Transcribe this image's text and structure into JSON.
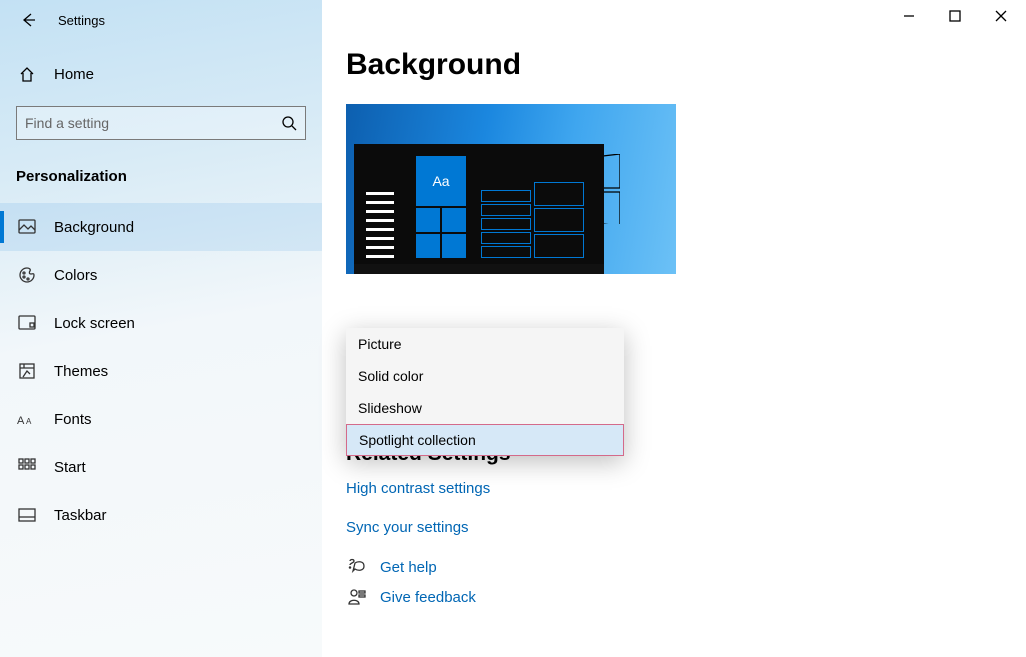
{
  "app": {
    "title": "Settings"
  },
  "sidebar": {
    "home_label": "Home",
    "search_placeholder": "Find a setting",
    "section_title": "Personalization",
    "items": [
      {
        "label": "Background"
      },
      {
        "label": "Colors"
      },
      {
        "label": "Lock screen"
      },
      {
        "label": "Themes"
      },
      {
        "label": "Fonts"
      },
      {
        "label": "Start"
      },
      {
        "label": "Taskbar"
      }
    ]
  },
  "main": {
    "title": "Background",
    "preview_tile_text": "Aa",
    "dropdown_options": [
      {
        "label": "Picture",
        "selected": false
      },
      {
        "label": "Solid color",
        "selected": false
      },
      {
        "label": "Slideshow",
        "selected": false
      },
      {
        "label": "Spotlight collection",
        "selected": true
      }
    ],
    "related": {
      "title": "Related Settings",
      "links": [
        {
          "label": "High contrast settings"
        },
        {
          "label": "Sync your settings"
        }
      ]
    },
    "help_links": [
      {
        "label": "Get help"
      },
      {
        "label": "Give feedback"
      }
    ]
  }
}
